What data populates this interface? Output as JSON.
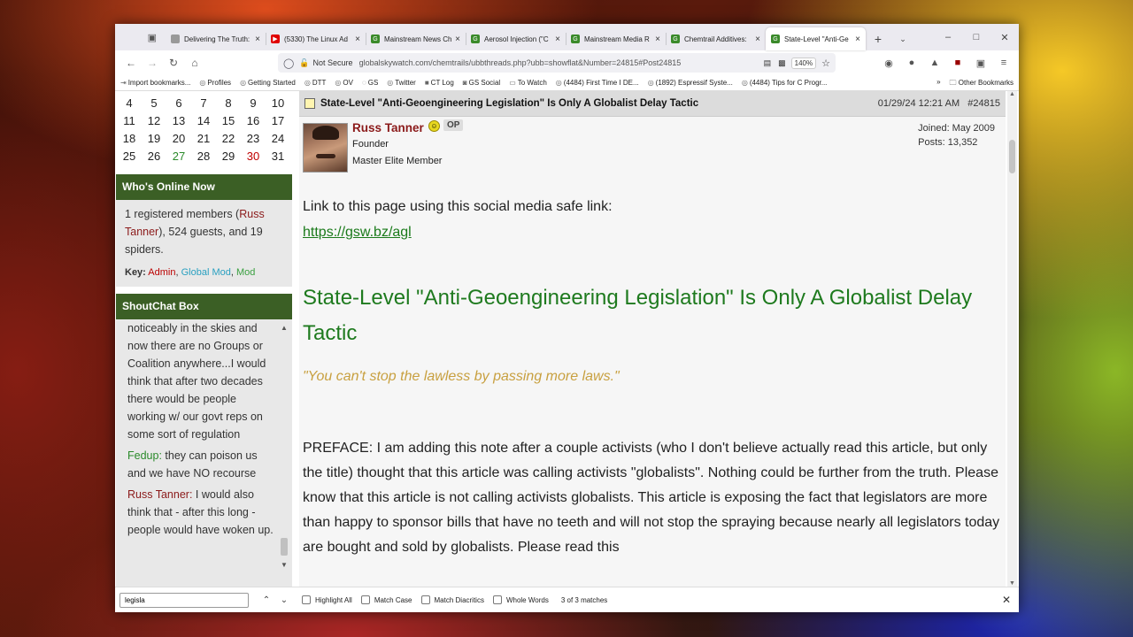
{
  "tabs": [
    {
      "label": "Delivering The Truth: eve",
      "fav": "doc",
      "color": "#999999"
    },
    {
      "label": "(5330) The Linux Ad",
      "fav": "youtube",
      "color": "#e00000"
    },
    {
      "label": "Mainstream News Ch",
      "fav": "gsw",
      "color": "#3a8a2a"
    },
    {
      "label": "Aerosol Injection (\"C",
      "fav": "gsw",
      "color": "#3a8a2a"
    },
    {
      "label": "Mainstream Media R",
      "fav": "gsw",
      "color": "#3a8a2a"
    },
    {
      "label": "Chemtrail Additives:",
      "fav": "gsw",
      "color": "#3a8a2a"
    },
    {
      "label": "State-Level \"Anti-Ge",
      "fav": "gsw",
      "color": "#3a8a2a",
      "active": true
    }
  ],
  "nav": {
    "not_secure": "Not Secure",
    "url": "globalskywatch.com/chemtrails/ubbthreads.php?ubb=showflat&Number=24815#Post24815",
    "zoom": "140%"
  },
  "bookmarks": [
    {
      "label": "Import bookmarks...",
      "icon": "import-icon"
    },
    {
      "label": "Profiles",
      "icon": "globe-icon"
    },
    {
      "label": "Getting Started",
      "icon": "globe-icon"
    },
    {
      "label": "DTT",
      "icon": "globe-icon"
    },
    {
      "label": "OV",
      "icon": "globe-icon"
    },
    {
      "label": "GS",
      "icon": "gs-icon"
    },
    {
      "label": "Twitter",
      "icon": "globe-icon"
    },
    {
      "label": "CT Log",
      "icon": "log-icon"
    },
    {
      "label": "GS Social",
      "icon": "mastodon-icon"
    },
    {
      "label": "To Watch",
      "icon": "folder-icon"
    },
    {
      "label": "(4484) First Time I DE...",
      "icon": "globe-icon"
    },
    {
      "label": "(1892) Espressif Syste...",
      "icon": "globe-icon"
    },
    {
      "label": "(4484) Tips for C Progr...",
      "icon": "globe-icon"
    }
  ],
  "bookmarks_other": "Other Bookmarks",
  "calendar": [
    [
      "4",
      "5",
      "6",
      "7",
      "8",
      "9",
      "10"
    ],
    [
      "11",
      "12",
      "13",
      "14",
      "15",
      "16",
      "17"
    ],
    [
      "18",
      "19",
      "20",
      "21",
      "22",
      "23",
      "24"
    ],
    [
      "25",
      "26",
      "27",
      "28",
      "29",
      "30",
      "31"
    ]
  ],
  "calendar_highlight": {
    "green": "27",
    "red": "30"
  },
  "online": {
    "header": "Who's Online Now",
    "pre": "1 registered members (",
    "member": "Russ Tanner",
    "post": "), 524 guests, and 19 spiders.",
    "key_label": "Key:",
    "admin": "Admin",
    "global_mod": "Global Mod",
    "mod": "Mod"
  },
  "shoutbox": {
    "header": "ShoutChat Box",
    "msg1": "noticeably in the skies and now there are no Groups or Coalition anywhere...I would think that after two decades there would be people working w/ our govt reps on some sort of regulation",
    "msg2_name": "Fedup:",
    "msg2_text": " they can poison us and we have NO recourse",
    "msg3_name": "Russ Tanner:",
    "msg3_text": " I would also think that - after this long - people would have woken up."
  },
  "post": {
    "header_title": "State-Level \"Anti-Geoengineering Legislation\" Is Only A Globalist Delay Tactic",
    "date": "01/29/24 12:21 AM",
    "number": "#24815",
    "author": "Russ Tanner",
    "op": "OP",
    "role": "Founder",
    "rank": "Master Elite Member",
    "joined": "Joined: May 2009",
    "posts": "Posts: 13,352",
    "link_intro": "Link to this page using this social media safe link:",
    "link": "https://gsw.bz/agl",
    "title": "State-Level \"Anti-Geoengineering Legislation\" Is Only A Globalist Delay Tactic",
    "quote": "\"You can't stop the lawless by passing more laws.\"",
    "preface": "PREFACE: I am adding this note after a couple activists (who I don't believe actually read this article, but only the title) thought that this article was calling activists \"globalists\". Nothing could be further from the truth. Please know that this article is not calling activists globalists. This article is exposing the fact that legislators are more than happy to sponsor bills that have no teeth and will not stop the spraying because nearly all legislators today are bought and sold by globalists. Please read this"
  },
  "find": {
    "value": "legisla",
    "highlight_all": "Highlight All",
    "match_case": "Match Case",
    "match_diacritics": "Match Diacritics",
    "whole_words": "Whole Words",
    "matches": "3 of 3 matches"
  }
}
